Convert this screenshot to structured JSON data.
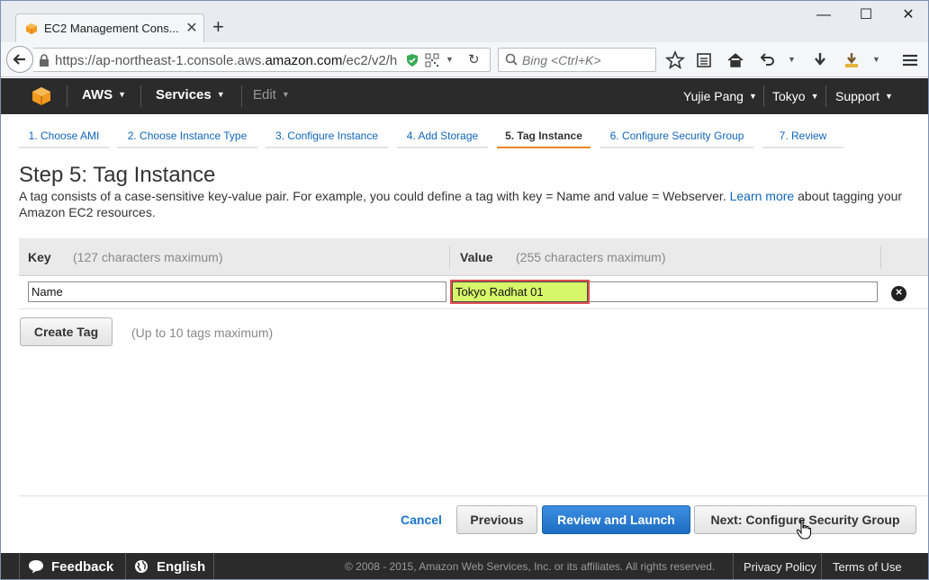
{
  "browser": {
    "tab_title": "EC2 Management Cons...",
    "url_prefix": "https://ap-northeast-1.console.aws.",
    "url_domain": "amazon.com",
    "url_suffix": "/ec2/v2/h",
    "search_placeholder": "Bing <Ctrl+K>"
  },
  "aws_header": {
    "aws_label": "AWS",
    "services_label": "Services",
    "edit_label": "Edit",
    "user_label": "Yujie Pang",
    "region_label": "Tokyo",
    "support_label": "Support"
  },
  "wizard": {
    "steps": [
      {
        "label": "1. Choose AMI",
        "active": false
      },
      {
        "label": "2. Choose Instance Type",
        "active": false
      },
      {
        "label": "3. Configure Instance",
        "active": false
      },
      {
        "label": "4. Add Storage",
        "active": false
      },
      {
        "label": "5. Tag Instance",
        "active": true
      },
      {
        "label": "6. Configure Security Group",
        "active": false
      },
      {
        "label": "7. Review",
        "active": false
      }
    ],
    "title": "Step 5: Tag Instance",
    "intro_before_link": "A tag consists of a case-sensitive key-value pair. For example, you could define a tag with key = Name and value = Webserver.",
    "intro_link": "Learn more",
    "intro_after_link": "about tagging your Amazon EC2 resources."
  },
  "tag_table": {
    "key_header": "Key",
    "key_hint": "(127 characters maximum)",
    "value_header": "Value",
    "value_hint": "(255 characters maximum)",
    "rows": [
      {
        "key": "Name",
        "value": "Tokyo Radhat 01"
      }
    ],
    "create_tag_label": "Create Tag",
    "create_tag_hint": "(Up to 10 tags maximum)"
  },
  "actions": {
    "cancel_label": "Cancel",
    "previous_label": "Previous",
    "review_launch_label": "Review and Launch",
    "next_label": "Next: Configure Security Group"
  },
  "bottom_bar": {
    "feedback_label": "Feedback",
    "language_label": "English",
    "copyright": "© 2008 - 2015, Amazon Web Services, Inc. or its affiliates. All rights reserved.",
    "privacy_label": "Privacy Policy",
    "terms_label": "Terms of Use"
  },
  "colors": {
    "aws_bar": "#2b2b2b",
    "active_step_underline": "#e8872b",
    "link_blue": "#1166bb",
    "primary_button": "#1b6dc1",
    "value_highlight": "#d6f76a",
    "highlight_outline": "#e05050"
  }
}
